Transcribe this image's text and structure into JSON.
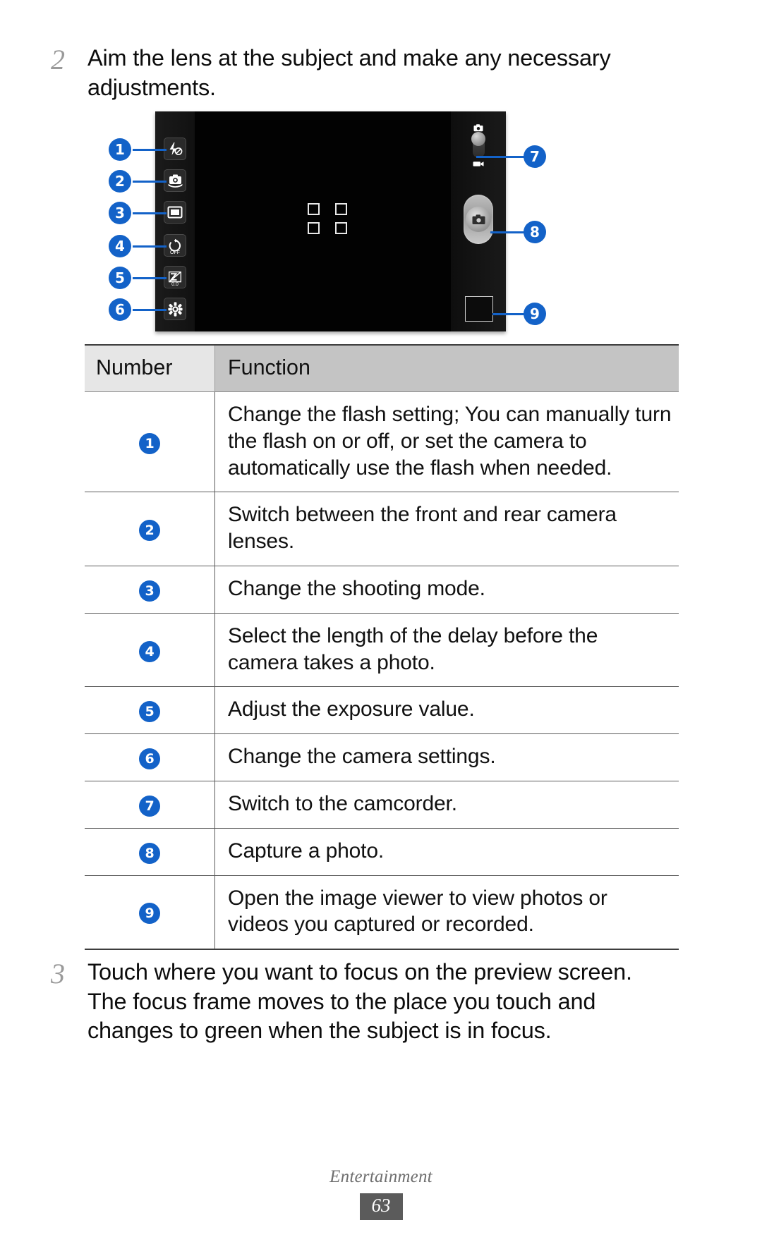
{
  "page": {
    "section": "Entertainment",
    "number": "63"
  },
  "steps": [
    {
      "number": "2",
      "text": "Aim the lens at the subject and make any necessary adjustments."
    },
    {
      "number": "3",
      "text": "Touch where you want to focus on the preview screen. The focus frame moves to the place you touch and changes to green when the subject is in focus."
    }
  ],
  "figure": {
    "name": "camera-preview-diagram",
    "callouts": [
      "1",
      "2",
      "3",
      "4",
      "5",
      "6",
      "7",
      "8",
      "9"
    ],
    "left_controls": [
      {
        "callout": "1",
        "icon": "flash-off-icon",
        "sublabel": ""
      },
      {
        "callout": "2",
        "icon": "switch-camera-icon",
        "sublabel": ""
      },
      {
        "callout": "3",
        "icon": "shooting-mode-icon",
        "sublabel": ""
      },
      {
        "callout": "4",
        "icon": "timer-icon",
        "sublabel": "OFF"
      },
      {
        "callout": "5",
        "icon": "exposure-icon",
        "sublabel": "0.0"
      },
      {
        "callout": "6",
        "icon": "settings-gear-icon",
        "sublabel": ""
      }
    ],
    "right_controls": [
      {
        "callout": "7",
        "icon": "camera-camcorder-toggle-icon"
      },
      {
        "callout": "8",
        "icon": "shutter-button-icon"
      },
      {
        "callout": "9",
        "icon": "image-viewer-thumbnail-icon"
      }
    ]
  },
  "table": {
    "headers": [
      "Number",
      "Function"
    ],
    "rows": [
      {
        "number": "1",
        "function": "Change the flash setting; You can manually turn the flash on or off, or set the camera to automatically use the flash when needed."
      },
      {
        "number": "2",
        "function": "Switch between the front and rear camera lenses."
      },
      {
        "number": "3",
        "function": "Change the shooting mode."
      },
      {
        "number": "4",
        "function": "Select the length of the delay before the camera takes a photo."
      },
      {
        "number": "5",
        "function": "Adjust the exposure value."
      },
      {
        "number": "6",
        "function": "Change the camera settings."
      },
      {
        "number": "7",
        "function": "Switch to the camcorder."
      },
      {
        "number": "8",
        "function": "Capture a photo."
      },
      {
        "number": "9",
        "function": "Open the image viewer to view photos or videos you captured or recorded."
      }
    ]
  },
  "colors": {
    "callout_blue": "#1362c8",
    "header_num_bg": "#e6e6e6",
    "header_fn_bg": "#c4c4c4",
    "footer_page_bg": "#5b5b5b"
  }
}
